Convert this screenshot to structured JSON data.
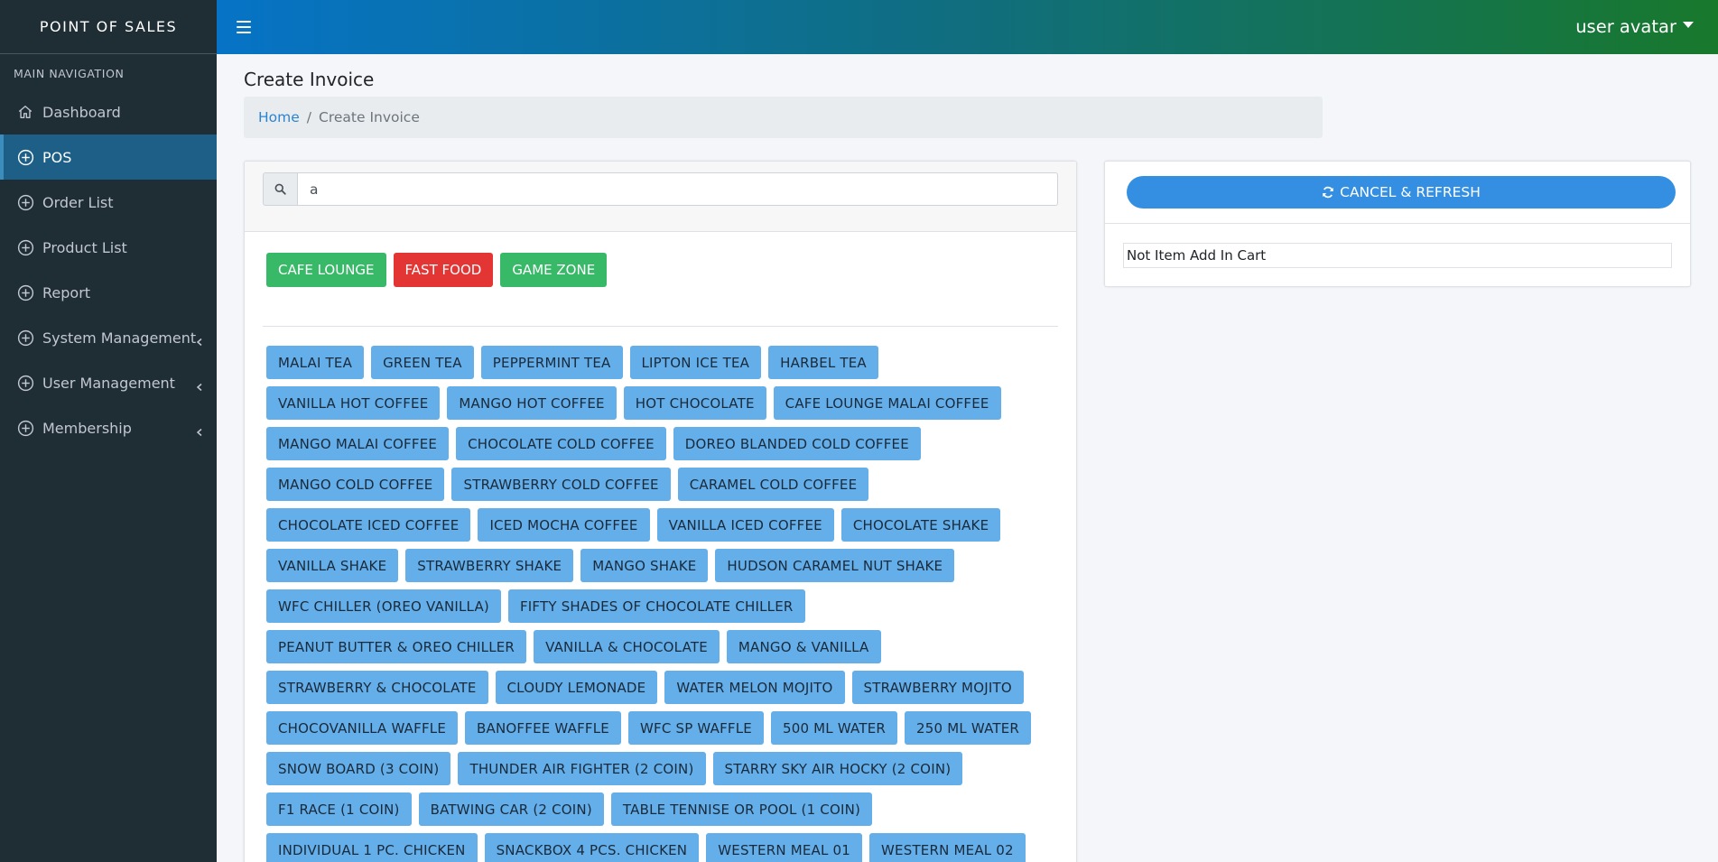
{
  "brand": "POINT OF SALES",
  "sidebar": {
    "header": "MAIN NAVIGATION",
    "items": [
      {
        "label": "Dashboard",
        "icon": "home-icon"
      },
      {
        "label": "POS",
        "icon": "plus-circle-icon",
        "active": true
      },
      {
        "label": "Order List",
        "icon": "plus-circle-icon"
      },
      {
        "label": "Product List",
        "icon": "plus-circle-icon"
      },
      {
        "label": "Report",
        "icon": "plus-circle-icon"
      },
      {
        "label": "System Management",
        "icon": "plus-circle-icon",
        "expandable": true
      },
      {
        "label": "User Management",
        "icon": "plus-circle-icon",
        "expandable": true
      },
      {
        "label": "Membership",
        "icon": "plus-circle-icon",
        "expandable": true
      }
    ]
  },
  "topbar": {
    "user_label": "user avatar"
  },
  "page": {
    "title": "Create Invoice",
    "breadcrumb": {
      "home": "Home",
      "separator": "/",
      "current": "Create Invoice"
    }
  },
  "search": {
    "value": "a",
    "placeholder": ""
  },
  "categories": [
    {
      "label": "CAFE LOUNGE",
      "color": "#37b967"
    },
    {
      "label": "FAST FOOD",
      "color": "#e43535"
    },
    {
      "label": "GAME ZONE",
      "color": "#37b967"
    }
  ],
  "product_rows": [
    [
      "MALAI TEA",
      "GREEN TEA",
      "PEPPERMINT TEA",
      "LIPTON ICE TEA",
      "HARBEL TEA"
    ],
    [
      "VANILLA HOT COFFEE",
      "MANGO HOT COFFEE",
      "HOT CHOCOLATE",
      "CAFE LOUNGE MALAI COFFEE"
    ],
    [
      "MANGO MALAI COFFEE",
      "CHOCOLATE COLD COFFEE",
      "DOREO BLANDED COLD COFFEE"
    ],
    [
      "MANGO COLD COFFEE",
      "STRAWBERRY COLD COFFEE",
      "CARAMEL COLD COFFEE"
    ],
    [
      "CHOCOLATE ICED COFFEE",
      "ICED MOCHA COFFEE",
      "VANILLA ICED COFFEE",
      "CHOCOLATE SHAKE"
    ],
    [
      "VANILLA SHAKE",
      "STRAWBERRY SHAKE",
      "MANGO SHAKE",
      "HUDSON CARAMEL NUT SHAKE"
    ],
    [
      "WFC CHILLER (OREO VANILLA)",
      "FIFTY SHADES OF CHOCOLATE CHILLER"
    ],
    [
      "PEANUT BUTTER & OREO CHILLER",
      "VANILLA & CHOCOLATE",
      "MANGO & VANILLA"
    ],
    [
      "STRAWBERRY & CHOCOLATE",
      "CLOUDY LEMONADE",
      "WATER MELON MOJITO",
      "STRAWBERRY MOJITO"
    ],
    [
      "CHOCOVANILLA WAFFLE",
      "BANOFFEE WAFFLE",
      "WFC SP WAFFLE",
      "500 ML WATER",
      "250 ML WATER"
    ],
    [
      "SNOW BOARD (3 COIN)",
      "THUNDER AIR FIGHTER (2 COIN)",
      "STARRY SKY AIR HOCKY (2 COIN)"
    ],
    [
      "F1 RACE (1 COIN)",
      "BATWING CAR (2 COIN)",
      "TABLE TENNISE OR POOL (1 COIN)"
    ],
    [
      "INDIVIDUAL 1 PC. CHICKEN",
      "SNACKBOX 4 PCS. CHICKEN",
      "WESTERN MEAL 01",
      "WESTERN MEAL 02"
    ]
  ],
  "cart": {
    "cancel_label": "CANCEL & REFRESH",
    "empty_message": "Not Item Add In Cart"
  },
  "colors": {
    "sidebar_bg": "#1f2d35",
    "active_nav": "#1d5f86",
    "product_button": "#64aeea",
    "accent_blue": "#348fe2",
    "category_green": "#37b967",
    "category_red": "#e43535"
  }
}
